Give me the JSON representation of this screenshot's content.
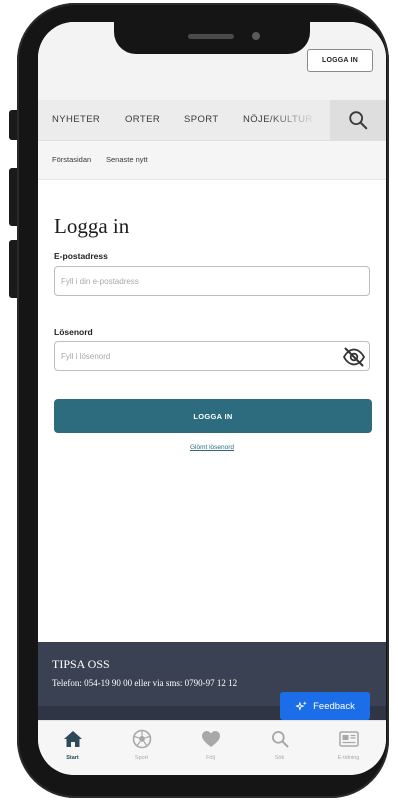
{
  "header": {
    "login_label": "LOGGA IN"
  },
  "nav": {
    "items": [
      {
        "label": "NYHETER"
      },
      {
        "label": "ORTER"
      },
      {
        "label": "SPORT"
      },
      {
        "label": "NÖJE/KULTUR"
      }
    ],
    "search_icon": "search-icon"
  },
  "subnav": {
    "items": [
      {
        "label": "Förstasidan"
      },
      {
        "label": "Senaste nytt"
      }
    ]
  },
  "login_form": {
    "title": "Logga in",
    "email": {
      "label": "E-postadress",
      "placeholder": "Fyll i din e-postadress",
      "value": ""
    },
    "password": {
      "label": "Lösenord",
      "placeholder": "Fyll i lösenord",
      "value": "",
      "toggle_icon": "eye-off-icon"
    },
    "submit_label": "LOGGA IN",
    "forgot_label": "Glömt lösenord"
  },
  "footer": {
    "title": "TIPSA OSS",
    "contact": "Telefon: 054-19 90 00 eller via sms: 0790-97 12 12"
  },
  "feedback": {
    "label": "Feedback",
    "icon": "sparkle-icon",
    "color": "#1c6ee8"
  },
  "tabbar": {
    "items": [
      {
        "label": "Start",
        "icon": "home-icon",
        "active": true
      },
      {
        "label": "Sport",
        "icon": "soccer-ball-icon",
        "active": false
      },
      {
        "label": "Följ",
        "icon": "heart-icon",
        "active": false
      },
      {
        "label": "Sök",
        "icon": "search-icon",
        "active": false
      },
      {
        "label": "E-tidning",
        "icon": "newspaper-icon",
        "active": false
      }
    ]
  },
  "colors": {
    "accent": "#2d6b7e",
    "footer": "#3a4152",
    "feedback": "#1c6ee8"
  }
}
